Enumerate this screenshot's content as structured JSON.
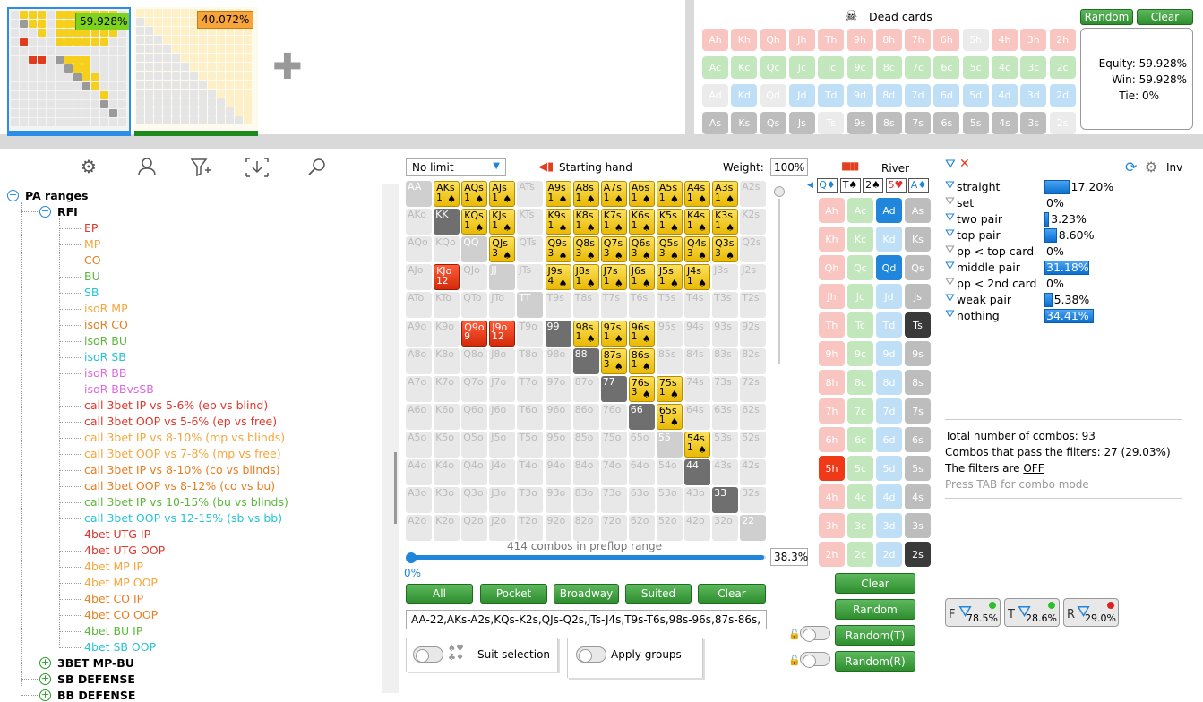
{
  "top": {
    "player1_equity": "59.928%",
    "player2_equity": "40.072%",
    "add_symbol": "✚"
  },
  "dead_cards": {
    "title": "Dead cards",
    "random_label": "Random",
    "clear_label": "Clear",
    "rows": [
      [
        "Ah",
        "Kh",
        "Qh",
        "Jh",
        "Th",
        "9h",
        "8h",
        "7h",
        "6h",
        "5h",
        "4h",
        "3h",
        "2h"
      ],
      [
        "Ac",
        "Kc",
        "Qc",
        "Jc",
        "Tc",
        "9c",
        "8c",
        "7c",
        "6c",
        "5c",
        "4c",
        "3c",
        "2c"
      ],
      [
        "Ad",
        "Kd",
        "Qd",
        "Jd",
        "Td",
        "9d",
        "8d",
        "7d",
        "6d",
        "5d",
        "4d",
        "3d",
        "2d"
      ],
      [
        "As",
        "Ks",
        "Qs",
        "Js",
        "Ts",
        "9s",
        "8s",
        "7s",
        "6s",
        "5s",
        "4s",
        "3s",
        "2s"
      ]
    ],
    "equity_label": "Equity: 59.928%",
    "win_label": "Win: 59.928%",
    "tie_label": "Tie: 0%"
  },
  "toolbar": {
    "gear": "⚙",
    "user": "👤",
    "filter": "⛛",
    "import": "⇩",
    "search": "⚲"
  },
  "tree": [
    {
      "label": "PA ranges",
      "color": "#000",
      "bold": true,
      "expander": "−"
    },
    {
      "label": "RFI",
      "color": "#000",
      "bold": true,
      "expander": "−"
    },
    {
      "label": "EP",
      "color": "#e0362b"
    },
    {
      "label": "MP",
      "color": "#f5a63c"
    },
    {
      "label": "CO",
      "color": "#e67e22"
    },
    {
      "label": "BU",
      "color": "#5cb83a"
    },
    {
      "label": "SB",
      "color": "#27c3d6"
    },
    {
      "label": "isoR MP",
      "color": "#f5a63c"
    },
    {
      "label": "isoR CO",
      "color": "#e67e22"
    },
    {
      "label": "isoR BU",
      "color": "#5cb83a"
    },
    {
      "label": "isoR SB",
      "color": "#27c3d6"
    },
    {
      "label": "isoR BB",
      "color": "#dc6adb"
    },
    {
      "label": "isoR BBvsSB",
      "color": "#dc6adb"
    },
    {
      "label": "call 3bet IP vs 5-6% (ep vs blind)",
      "color": "#e0362b"
    },
    {
      "label": "call 3bet OOP vs 5-6% (ep vs free)",
      "color": "#e0362b"
    },
    {
      "label": "call 3bet IP vs 8-10% (mp vs blinds)",
      "color": "#f5a63c"
    },
    {
      "label": "call 3bet OOP vs 7-8% (mp vs free)",
      "color": "#f5a63c"
    },
    {
      "label": "call 3bet IP vs 8-10% (co vs blinds)",
      "color": "#e67e22"
    },
    {
      "label": "call 3bet OOP vs 8-12% (co vs bu)",
      "color": "#e67e22"
    },
    {
      "label": "call 3bet IP vs 10-15% (bu vs blinds)",
      "color": "#5cb83a"
    },
    {
      "label": "call 3bet OOP vs 12-15% (sb vs bb)",
      "color": "#27c3d6"
    },
    {
      "label": "4bet UTG IP",
      "color": "#e0362b"
    },
    {
      "label": "4bet UTG OOP",
      "color": "#e0362b"
    },
    {
      "label": "4bet MP IP",
      "color": "#f5a63c"
    },
    {
      "label": "4bet MP OOP",
      "color": "#f5a63c"
    },
    {
      "label": "4bet CO IP",
      "color": "#e67e22"
    },
    {
      "label": "4bet CO OOP",
      "color": "#e67e22"
    },
    {
      "label": "4bet BU IP",
      "color": "#5cb83a"
    },
    {
      "label": "4bet SB OOP",
      "color": "#27c3d6"
    },
    {
      "label": "3BET MP-BU",
      "color": "#000",
      "bold": true,
      "expander": "+"
    },
    {
      "label": "SB DEFENSE",
      "color": "#000",
      "bold": true,
      "expander": "+"
    },
    {
      "label": "BB DEFENSE",
      "color": "#000",
      "bold": true,
      "expander": "+"
    }
  ],
  "range": {
    "mode_select": "No limit",
    "starting_hand_label": "Starting hand",
    "weight_label": "Weight:",
    "weight_value": "100%",
    "combos_label": "414 combos in preflop range",
    "slider_min": "0%",
    "slider_value": "38.3%",
    "slider_fraction": 0.383,
    "buttons": [
      "All",
      "Pocket",
      "Broadway",
      "Suited",
      "Clear"
    ],
    "range_text": "AA-22,AKs-A2s,KQs-K2s,QJs-Q2s,JTs-J4s,T9s-T6s,98s-96s,87s-86s,",
    "suit_selection_label": "Suit selection",
    "apply_groups_label": "Apply groups"
  },
  "grid": {
    "ranks": [
      "A",
      "K",
      "Q",
      "J",
      "T",
      "9",
      "8",
      "7",
      "6",
      "5",
      "4",
      "3",
      "2"
    ],
    "states": [
      "o y y y o y y y y y y y o",
      "o gd y y o y y y y y y y o",
      "o o o y o y y y y y y y o",
      "o r o o o y y y y y y o o",
      "o o o o o o o o o o o o o",
      "o o r r o gd y y y o o o o",
      "o o o o o o gd y y o o o o",
      "o o o o o o o gd y y o o o",
      "o o o o o o o o gd y o o o",
      "o o o o o o o o o o y o o",
      "o o o o o o o o o o gd o o",
      "o o o o o o o o o o o gd o",
      "o o o o o o o o o o o o o"
    ],
    "counts": {
      "0,1": "1",
      "0,2": "1",
      "0,3": "1",
      "0,5": "1",
      "0,6": "1",
      "0,7": "1",
      "0,8": "1",
      "0,9": "1",
      "0,10": "1",
      "0,11": "1",
      "1,2": "1",
      "1,3": "1",
      "1,5": "1",
      "1,6": "1",
      "1,7": "1",
      "1,8": "1",
      "1,9": "1",
      "1,10": "1",
      "1,11": "1",
      "2,3": "3",
      "2,5": "3",
      "2,6": "3",
      "2,7": "3",
      "2,8": "3",
      "2,9": "3",
      "2,10": "3",
      "2,11": "3",
      "3,1": "12",
      "3,5": "4",
      "3,6": "1",
      "3,7": "1",
      "3,8": "1",
      "3,9": "1",
      "3,10": "1",
      "5,2": "9",
      "5,3": "12",
      "5,6": "1",
      "5,7": "1",
      "5,8": "1",
      "6,7": "3",
      "6,8": "1",
      "7,8": "3",
      "7,9": "1",
      "8,9": "1",
      "9,10": "1"
    }
  },
  "board": {
    "title": "River",
    "slots": [
      "Q♦",
      "T♠",
      "2♠",
      "5♥",
      "A♦"
    ],
    "hearts": [
      "Ah",
      "Kh",
      "Qh",
      "Jh",
      "Th",
      "9h",
      "8h",
      "7h",
      "6h",
      "5h",
      "4h",
      "3h",
      "2h"
    ],
    "clubs": [
      "Ac",
      "Kc",
      "Qc",
      "Jc",
      "Tc",
      "9c",
      "8c",
      "7c",
      "6c",
      "5c",
      "4c",
      "3c",
      "2c"
    ],
    "diamonds": [
      "Ad",
      "Kd",
      "Qd",
      "Jd",
      "Td",
      "9d",
      "8d",
      "7d",
      "6d",
      "5d",
      "4d",
      "3d",
      "2d"
    ],
    "spades": [
      "As",
      "Ks",
      "Qs",
      "Js",
      "Ts",
      "9s",
      "8s",
      "7s",
      "6s",
      "5s",
      "4s",
      "3s",
      "2s"
    ],
    "ad_badge": "R",
    "fiveh_badge": "T",
    "buttons": [
      "Clear",
      "Random",
      "Random(T)",
      "Random(R)"
    ]
  },
  "filters": {
    "inv_label": "Inv",
    "rows": [
      {
        "label": "straight",
        "value": "17.20%",
        "fraction": 0.172
      },
      {
        "label": "set",
        "value": "0%",
        "fraction": 0
      },
      {
        "label": "two pair",
        "value": "3.23%",
        "fraction": 0.0323
      },
      {
        "label": "top pair",
        "value": "8.60%",
        "fraction": 0.086
      },
      {
        "label": "pp < top card",
        "value": "0%",
        "fraction": 0
      },
      {
        "label": "middle pair",
        "value": "31.18%",
        "fraction": 0.3118
      },
      {
        "label": "pp < 2nd card",
        "value": "0%",
        "fraction": 0
      },
      {
        "label": "weak pair",
        "value": "5.38%",
        "fraction": 0.0538
      },
      {
        "label": "nothing",
        "value": "34.41%",
        "fraction": 0.3441
      }
    ],
    "total_combos": "Total number of combos: 93",
    "pass_combos": "Combos that pass the filters: 27 (29.03%)",
    "filters_are": "The filters are",
    "filters_state": "OFF",
    "tab_hint": "Press TAB for combo mode",
    "indicators": [
      {
        "letter": "F",
        "value": "78.5%"
      },
      {
        "letter": "T",
        "value": "28.6%"
      },
      {
        "letter": "R",
        "value": "29.0%"
      }
    ]
  },
  "colors": {
    "accent_blue": "#1f86db",
    "green": "#2f8f2f",
    "gold": "#f5cf1c"
  }
}
